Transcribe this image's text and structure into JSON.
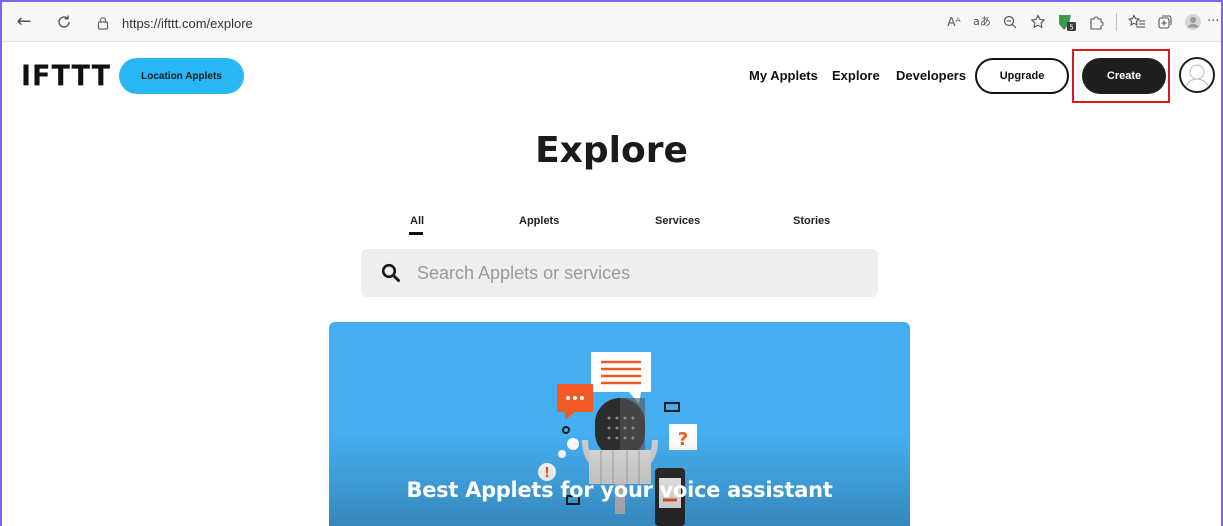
{
  "browser": {
    "url": "https://ifttt.com/explore",
    "back_icon": "←",
    "refresh_icon": "⟳",
    "toolbar_icons": [
      "read-aloud-icon",
      "translate-icon",
      "zoom-icon",
      "favorite-icon",
      "extension-icon",
      "puzzle-icon",
      "favorites-icon",
      "collections-icon",
      "profile-icon",
      "more-icon"
    ],
    "read_aloud": "Aᴬ",
    "translate": "aあ",
    "more": "···"
  },
  "header": {
    "logo": "IFTTT",
    "location_button": "Location Applets",
    "nav": {
      "my_applets": "My Applets",
      "explore": "Explore",
      "developers": "Developers"
    },
    "upgrade": "Upgrade",
    "create": "Create"
  },
  "main": {
    "title": "Explore",
    "tabs": [
      {
        "label": "All",
        "active": true
      },
      {
        "label": "Applets",
        "active": false
      },
      {
        "label": "Services",
        "active": false
      },
      {
        "label": "Stories",
        "active": false
      }
    ],
    "search": {
      "placeholder": "Search Applets or services"
    },
    "featured_card": {
      "title": "Best Applets for your voice assistant",
      "background_color": "#45aef0"
    }
  },
  "colors": {
    "accent_blue": "#29b6f6",
    "create_bg": "#1f1f1f",
    "highlight": "#e0181f",
    "window_border": "#7d63f0"
  }
}
